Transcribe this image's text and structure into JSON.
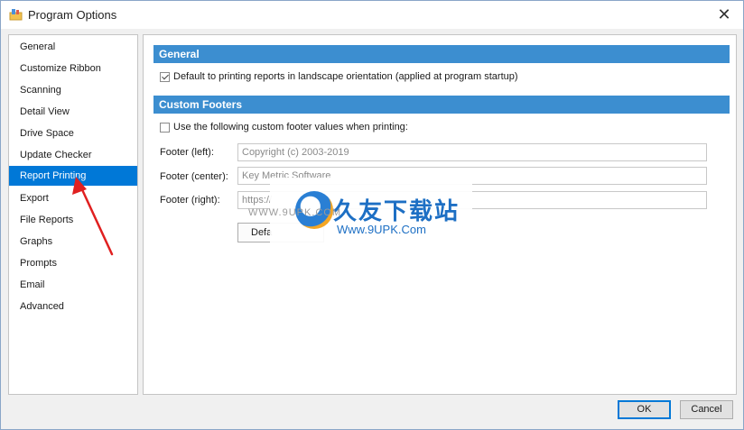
{
  "window": {
    "title": "Program Options"
  },
  "nav": {
    "items": [
      {
        "label": "General"
      },
      {
        "label": "Customize Ribbon"
      },
      {
        "label": "Scanning"
      },
      {
        "label": "Detail View"
      },
      {
        "label": "Drive Space"
      },
      {
        "label": "Update Checker"
      },
      {
        "label": "Report Printing",
        "selected": true
      },
      {
        "label": "Export"
      },
      {
        "label": "File Reports"
      },
      {
        "label": "Graphs"
      },
      {
        "label": "Prompts"
      },
      {
        "label": "Email"
      },
      {
        "label": "Advanced"
      }
    ]
  },
  "general": {
    "header": "General",
    "landscape_label": "Default to printing reports in landscape orientation (applied at program startup)",
    "landscape_checked": true
  },
  "footers": {
    "header": "Custom Footers",
    "use_custom_label": "Use the following custom footer values when printing:",
    "use_custom_checked": false,
    "left_label": "Footer (left):",
    "left_value": "Copyright (c) 2003-2019",
    "center_label": "Footer (center):",
    "center_value": "Key Metric Software",
    "right_label": "Footer (right):",
    "right_value": "https://",
    "defaults_button": "Defa"
  },
  "watermark": {
    "cn_text": "久友下载站",
    "en_text": "Www.9UPK.Com",
    "small_text": "WWW.9UPK.COM"
  },
  "buttons": {
    "ok": "OK",
    "cancel": "Cancel"
  },
  "colors": {
    "accent": "#0078d7",
    "section_header": "#3c8ed0",
    "arrow": "#e02020"
  }
}
